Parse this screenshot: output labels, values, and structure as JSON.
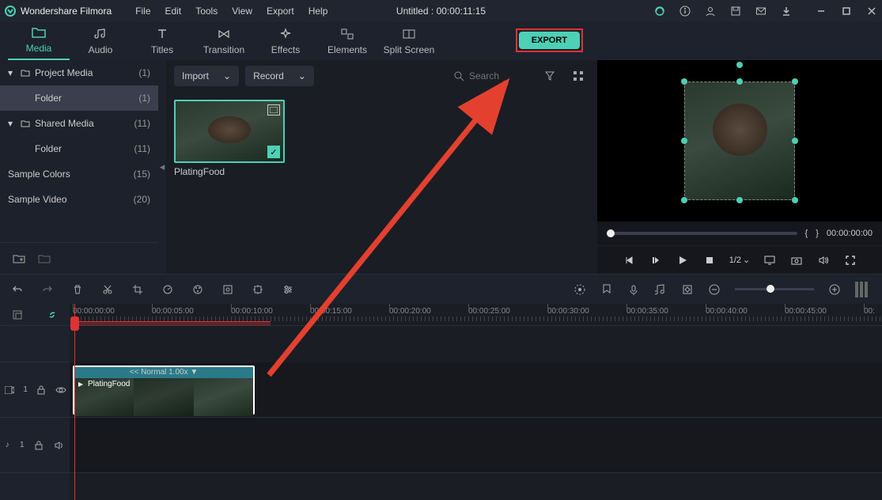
{
  "app": {
    "name": "Wondershare Filmora"
  },
  "menu": [
    "File",
    "Edit",
    "Tools",
    "View",
    "Export",
    "Help"
  ],
  "title": "Untitled : 00:00:11:15",
  "tabs": [
    {
      "label": "Media",
      "active": true
    },
    {
      "label": "Audio",
      "active": false
    },
    {
      "label": "Titles",
      "active": false
    },
    {
      "label": "Transition",
      "active": false
    },
    {
      "label": "Effects",
      "active": false
    },
    {
      "label": "Elements",
      "active": false
    },
    {
      "label": "Split Screen",
      "active": false
    }
  ],
  "export_label": "EXPORT",
  "sidebar": {
    "items": [
      {
        "label": "Project Media",
        "count": "(1)",
        "type": "header"
      },
      {
        "label": "Folder",
        "count": "(1)",
        "type": "item",
        "selected": true
      },
      {
        "label": "Shared Media",
        "count": "(11)",
        "type": "header"
      },
      {
        "label": "Folder",
        "count": "(11)",
        "type": "item"
      },
      {
        "label": "Sample Colors",
        "count": "(15)",
        "type": "plain"
      },
      {
        "label": "Sample Video",
        "count": "(20)",
        "type": "plain"
      }
    ]
  },
  "media_bar": {
    "import": "Import",
    "record": "Record",
    "search_ph": "Search"
  },
  "clip": {
    "name": "PlatingFood",
    "speed": "<< Normal 1.00x ▼"
  },
  "preview": {
    "timecode": "00:00:00:00",
    "speed": "1/2",
    "markers": {
      "in": "{",
      "out": "}"
    }
  },
  "ruler": [
    "00:00:00:00",
    "00:00:05:00",
    "00:00:10:00",
    "00:00:15:00",
    "00:00:20:00",
    "00:00:25:00",
    "00:00:30:00",
    "00:00:35:00",
    "00:00:40:00",
    "00:00:45:00",
    "00:"
  ],
  "tracks": {
    "video": "1",
    "audio": "1"
  },
  "audio_prefix": "♪"
}
